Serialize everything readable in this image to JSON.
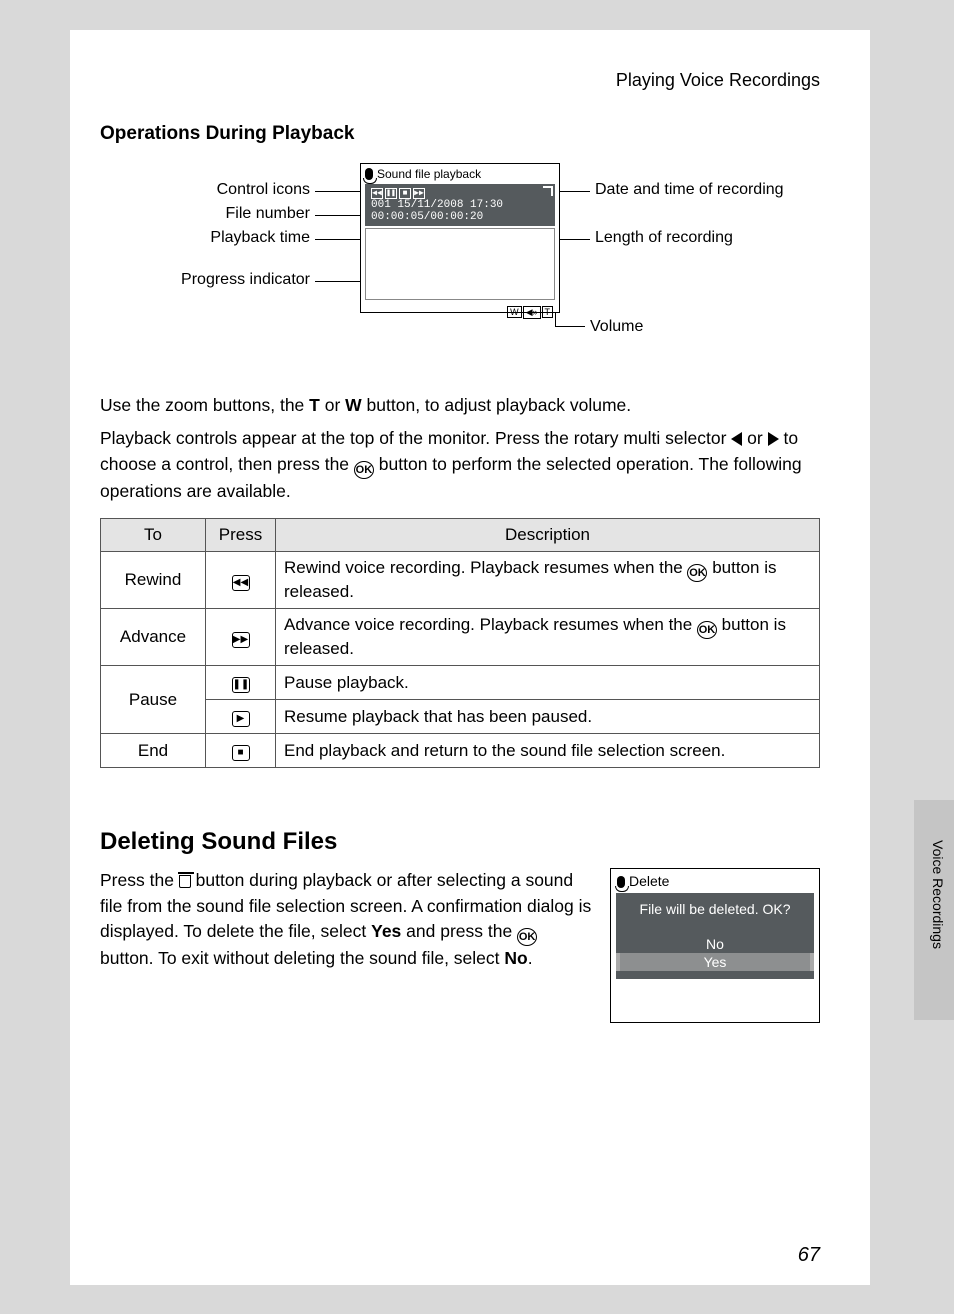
{
  "header": "Playing Voice Recordings",
  "section1_title": "Operations During Playback",
  "diagram": {
    "screen_title": "Sound file playback",
    "file_line": "001 15/11/2008 17:30",
    "time_line": "00:00:05/00:00:20",
    "labels_left": [
      "Control icons",
      "File number",
      "Playback time",
      "Progress indicator"
    ],
    "labels_right": [
      "Date and time of recording",
      "Length of recording",
      "Volume"
    ]
  },
  "para1_a": "Use the zoom buttons, the ",
  "para1_T": "T",
  "para1_b": " or ",
  "para1_W": "W",
  "para1_c": " button, to adjust playback volume.",
  "para2_a": "Playback controls appear at the top of the monitor. Press the rotary multi selector ",
  "para2_b": " or ",
  "para2_c": " to choose a control, then press the ",
  "para2_d": " button to perform the selected operation. The following operations are available.",
  "ok_label": "OK",
  "table": {
    "headers": [
      "To",
      "Press",
      "Description"
    ],
    "rows": [
      {
        "to": "Rewind",
        "icon": "◀◀",
        "desc_a": "Rewind voice recording. Playback resumes when the ",
        "desc_b": " button is released."
      },
      {
        "to": "Advance",
        "icon": "▶▶",
        "desc_a": "Advance voice recording. Playback resumes when the ",
        "desc_b": " button is released."
      }
    ],
    "pause_label": "Pause",
    "pause_icon": "❚❚",
    "pause_desc": "Pause playback.",
    "play_icon": "▶",
    "resume_desc": "Resume playback that has been paused.",
    "end_label": "End",
    "end_icon": "■",
    "end_desc": "End playback and return to the sound file selection screen."
  },
  "section2_title": "Deleting Sound Files",
  "del_para_a": "Press the ",
  "del_para_b": " button during playback or after selecting a sound file from the sound file selection screen. A confirmation dialog is displayed. To delete the file, select ",
  "del_yes": "Yes",
  "del_para_c": " and press the ",
  "del_para_d": " button. To exit without deleting the sound file, select ",
  "del_no": "No",
  "del_para_e": ".",
  "del_screen": {
    "title": "Delete",
    "msg": "File will be deleted. OK?",
    "opt_no": "No",
    "opt_yes": "Yes"
  },
  "side_label": "Voice Recordings",
  "page_number": "67"
}
